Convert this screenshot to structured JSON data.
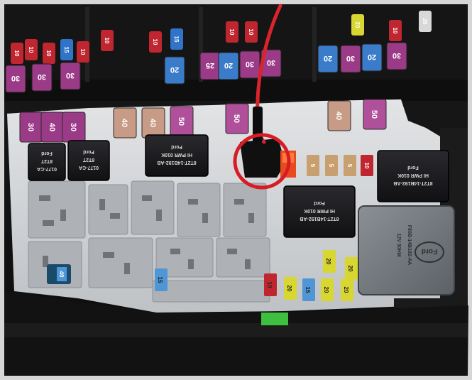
{
  "photo": {
    "fuses_top": [
      {
        "rating": "10",
        "color": "#c0262f"
      },
      {
        "rating": "10",
        "color": "#c0262f"
      },
      {
        "rating": "10",
        "color": "#c0262f"
      },
      {
        "rating": "15",
        "color": "#2f74c9"
      },
      {
        "rating": "10",
        "color": "#c0262f"
      },
      {
        "rating": "10",
        "color": "#c0262f"
      },
      {
        "rating": "10",
        "color": "#c0262f"
      },
      {
        "rating": "15",
        "color": "#2f74c9"
      },
      {
        "rating": "10",
        "color": "#c0262f"
      },
      {
        "rating": "10",
        "color": "#c0262f"
      },
      {
        "rating": "20",
        "color": "#d8d630"
      },
      {
        "rating": "10",
        "color": "#c0262f"
      },
      {
        "rating": "25",
        "color": "#d8d8d8"
      }
    ],
    "maxi_top": [
      {
        "rating": "30",
        "color": "#9b3a86"
      },
      {
        "rating": "30",
        "color": "#9b3a86"
      },
      {
        "rating": "30",
        "color": "#9b3a86"
      },
      {
        "rating": "20",
        "color": "#3a7cc9"
      },
      {
        "rating": "25",
        "color": "#9b3a86"
      },
      {
        "rating": "20",
        "color": "#3a7cc9"
      },
      {
        "rating": "30",
        "color": "#9b3a86"
      },
      {
        "rating": "30",
        "color": "#9b3a86"
      },
      {
        "rating": "20",
        "color": "#3a7cc9"
      },
      {
        "rating": "30",
        "color": "#9b3a86"
      },
      {
        "rating": "20",
        "color": "#3a7cc9"
      },
      {
        "rating": "30",
        "color": "#9b3a86"
      }
    ],
    "maxi_mid": [
      {
        "rating": "30",
        "color": "#9b3a86"
      },
      {
        "rating": "40",
        "color": "#9b3a86"
      },
      {
        "rating": "30",
        "color": "#9b3a86"
      },
      {
        "rating": "40",
        "color": "#c89b86"
      },
      {
        "rating": "40",
        "color": "#c89b86"
      },
      {
        "rating": "50",
        "color": "#b0509b"
      },
      {
        "rating": "50",
        "color": "#b0509b"
      },
      {
        "rating": "40",
        "color": "#c89b86"
      },
      {
        "rating": "50",
        "color": "#b0509b"
      }
    ],
    "mini_low": [
      {
        "rating": "15",
        "color": "#4e96d6"
      },
      {
        "rating": "10",
        "color": "#c0262f"
      },
      {
        "rating": "20",
        "color": "#d8d630"
      },
      {
        "rating": "15",
        "color": "#4e96d6"
      },
      {
        "rating": "20",
        "color": "#d8d630"
      },
      {
        "rating": "20",
        "color": "#d8d630"
      },
      {
        "rating": "20",
        "color": "#d8d630"
      },
      {
        "rating": "20",
        "color": "#d8d630"
      },
      {
        "rating": "20",
        "color": "#d8d630"
      }
    ],
    "small_fuses": [
      {
        "rating": "5",
        "color": "#c8a070"
      },
      {
        "rating": "5",
        "color": "#c8a070"
      },
      {
        "rating": "5",
        "color": "#c8a070"
      },
      {
        "rating": "10",
        "color": "#c0262f"
      }
    ],
    "relays": [
      {
        "brand": "Ford",
        "line1": "0177-CA",
        "line2": "8T2T"
      },
      {
        "brand": "Ford",
        "line1": "0177-CA",
        "line2": "8T2T"
      },
      {
        "brand": "Ford",
        "line1": "8T2T-14B192-AB",
        "line2": "HI PWR 010K"
      },
      {
        "brand": "Ford",
        "line1": "8T2T-14B192-AB",
        "line2": "HI PWR 010K"
      },
      {
        "brand": "Ford",
        "line1": "8T2T-14B192-AB",
        "line2": "HI PWR 010K"
      }
    ],
    "big_relay": {
      "brand": "Ford",
      "line1": "F80B-14B192-AA",
      "line2": "12V 50HM"
    },
    "tap_highlight_color": "#d81c24",
    "wire_color": "#d8242a",
    "green_tag_color": "#3fbf3f"
  }
}
